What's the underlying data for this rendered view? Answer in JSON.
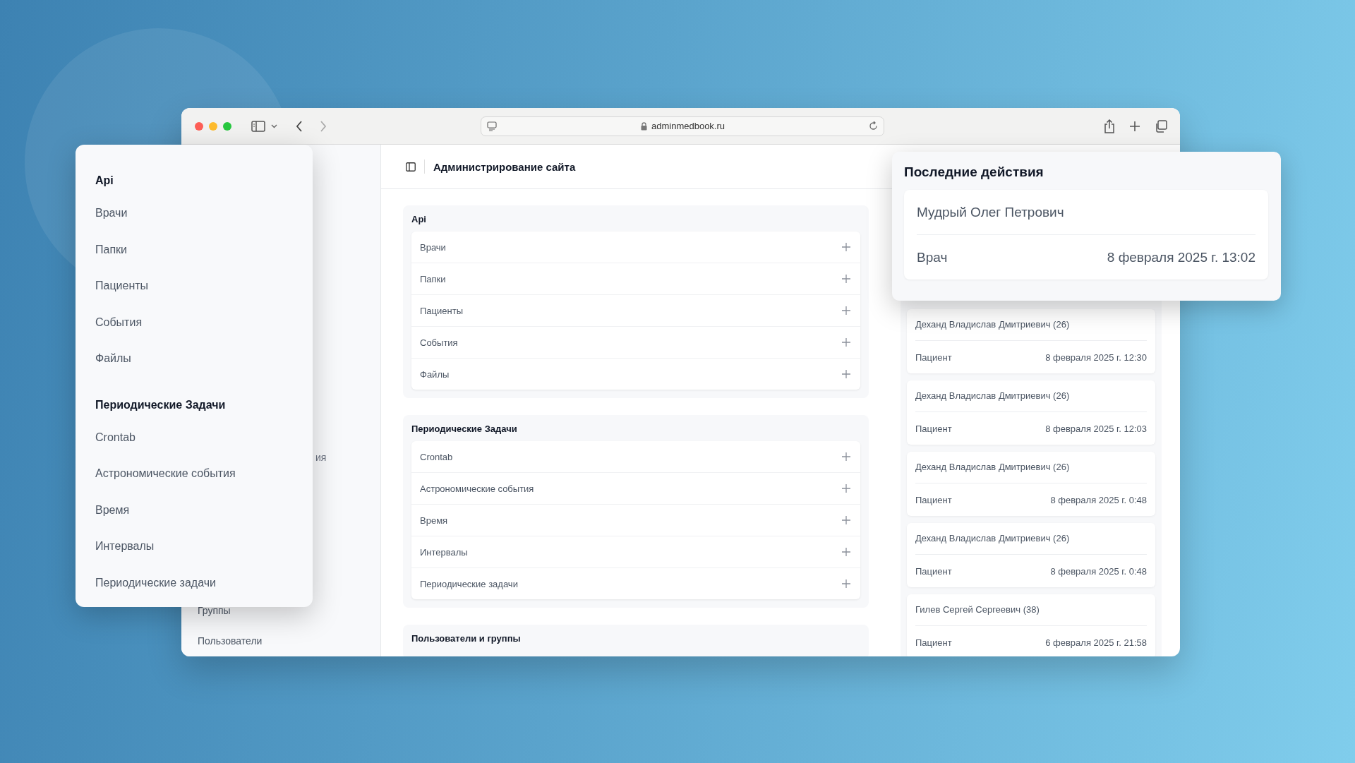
{
  "browser": {
    "url": "adminmedbook.ru"
  },
  "sidebar": {
    "items": [
      {
        "label": "ия",
        "kind": "partial"
      },
      {
        "label": "Группы",
        "kind": "full"
      },
      {
        "label": "Пользователи",
        "kind": "full"
      }
    ]
  },
  "header": {
    "title": "Администрирование сайта"
  },
  "sections": [
    {
      "title": "Api",
      "items": [
        "Врачи",
        "Папки",
        "Пациенты",
        "События",
        "Файлы"
      ]
    },
    {
      "title": "Периодические Задачи",
      "items": [
        "Crontab",
        "Астрономические события",
        "Время",
        "Интервалы",
        "Периодические задачи"
      ]
    },
    {
      "title": "Пользователи и группы"
    }
  ],
  "recent_actions": {
    "items": [
      {
        "name": "Деханд Владислав Дмитриевич (26)",
        "role": "Пациент",
        "date": "8 февраля 2025 г. 12:30"
      },
      {
        "name": "Деханд Владислав Дмитриевич (26)",
        "role": "Пациент",
        "date": "8 февраля 2025 г. 12:03"
      },
      {
        "name": "Деханд Владислав Дмитриевич (26)",
        "role": "Пациент",
        "date": "8 февраля 2025 г. 0:48"
      },
      {
        "name": "Деханд Владислав Дмитриевич (26)",
        "role": "Пациент",
        "date": "8 февраля 2025 г. 0:48"
      },
      {
        "name": "Гилев Сергей Сергеевич (38)",
        "role": "Пациент",
        "date": "6 февраля 2025 г. 21:58"
      }
    ]
  },
  "menu_popup": {
    "groups": [
      {
        "title": "Api",
        "items": [
          "Врачи",
          "Папки",
          "Пациенты",
          "События",
          "Файлы"
        ]
      },
      {
        "title": "Периодические Задачи",
        "items": [
          "Crontab",
          "Астрономические события",
          "Время",
          "Интервалы",
          "Периодические задачи"
        ]
      }
    ]
  },
  "recent_popup": {
    "title": "Последние действия",
    "item": {
      "name": "Мудрый Олег Петрович",
      "role": "Врач",
      "date": "8 февраля 2025 г. 13:02"
    }
  }
}
